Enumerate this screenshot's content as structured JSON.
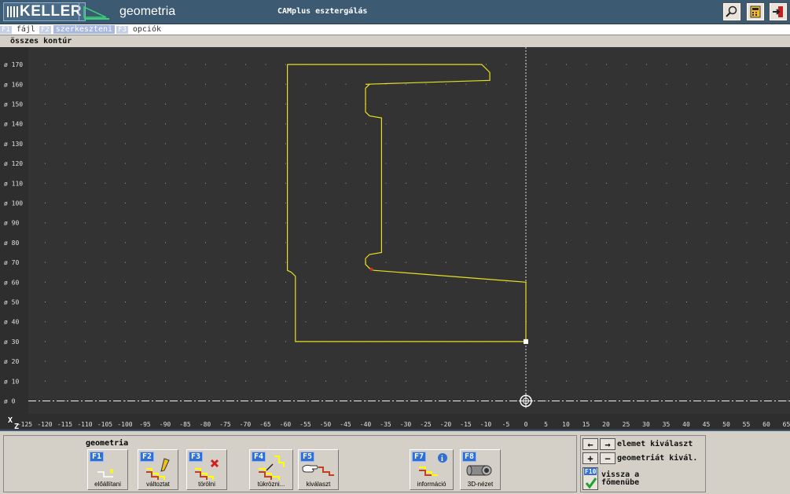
{
  "header": {
    "logo_text": "KELLER",
    "app_name": "geometria",
    "title": "CAMplus esztergálás",
    "buttons": [
      {
        "icon": "magnifier-icon"
      },
      {
        "icon": "calculator-icon"
      },
      {
        "icon": "exit-icon"
      }
    ]
  },
  "menu": {
    "items": [
      {
        "key": "F1",
        "label": "fájl"
      },
      {
        "key": "F2",
        "label": "szerkeszteni"
      },
      {
        "key": "F3",
        "label": "opciók"
      }
    ],
    "active": "szerkeszteni"
  },
  "contour_label": "összes kontúr",
  "canvas": {
    "x_axis_label": "Z",
    "y_axis_label": "X",
    "y_ticks": [
      170,
      160,
      150,
      140,
      130,
      120,
      110,
      100,
      90,
      80,
      70,
      60,
      50,
      40,
      30,
      20,
      10,
      0
    ],
    "y_prefix": "ø",
    "x_ticks": [
      -125,
      -120,
      -115,
      -110,
      -105,
      -100,
      -95,
      -90,
      -85,
      -80,
      -75,
      -70,
      -65,
      -60,
      -55,
      -50,
      -45,
      -40,
      -35,
      -30,
      -25,
      -20,
      -15,
      -10,
      -5,
      0,
      5,
      10,
      15,
      20,
      25,
      30,
      35,
      40,
      45,
      50,
      55,
      60,
      65
    ],
    "contour": [
      [
        -59.5,
        170
      ],
      [
        -11,
        170
      ],
      [
        -9,
        166
      ],
      [
        -9,
        162
      ],
      [
        -40,
        160
      ],
      [
        -40,
        160
      ],
      [
        -39,
        160
      ],
      [
        -40,
        158
      ],
      [
        -40,
        146
      ],
      [
        -39,
        144
      ],
      [
        -36,
        143
      ],
      [
        -36,
        75
      ],
      [
        -39,
        74
      ],
      [
        -40,
        72
      ],
      [
        -40,
        69
      ],
      [
        -39,
        67
      ],
      [
        -38,
        66
      ],
      [
        0,
        60
      ],
      [
        0,
        30
      ],
      [
        -57.5,
        30
      ],
      [
        -57.5,
        63
      ],
      [
        -58.5,
        65
      ],
      [
        -59.5,
        66
      ],
      [
        -59.5,
        170
      ]
    ],
    "red_mark": [
      -38.5,
      66.5
    ],
    "accent_color": "#e8e020",
    "origin_cursor_x": 0
  },
  "bottom": {
    "panel_title": "geometria",
    "fkeys": [
      {
        "key": "F1",
        "label": "előállítani",
        "icon": "generate-icon"
      },
      {
        "key": "F2",
        "label": "változtat",
        "icon": "edit-pencil-icon"
      },
      {
        "key": "F3",
        "label": "törölni",
        "icon": "delete-x-icon"
      },
      {
        "key": "F4",
        "label": "tükrözni...",
        "icon": "mirror-icon"
      },
      {
        "key": "F5",
        "label": "kiválaszt",
        "icon": "select-hand-icon"
      },
      {
        "key": "F7",
        "label": "információ",
        "icon": "info-icon"
      },
      {
        "key": "F8",
        "label": "3D-nézet",
        "icon": "3d-view-icon"
      }
    ],
    "nav": {
      "row1_label": "elemet kiválaszt",
      "row2_label": "geometriát kivál.",
      "f10_key": "F10",
      "f10_label_1": "vissza a",
      "f10_label_2": "főmenübe"
    }
  }
}
